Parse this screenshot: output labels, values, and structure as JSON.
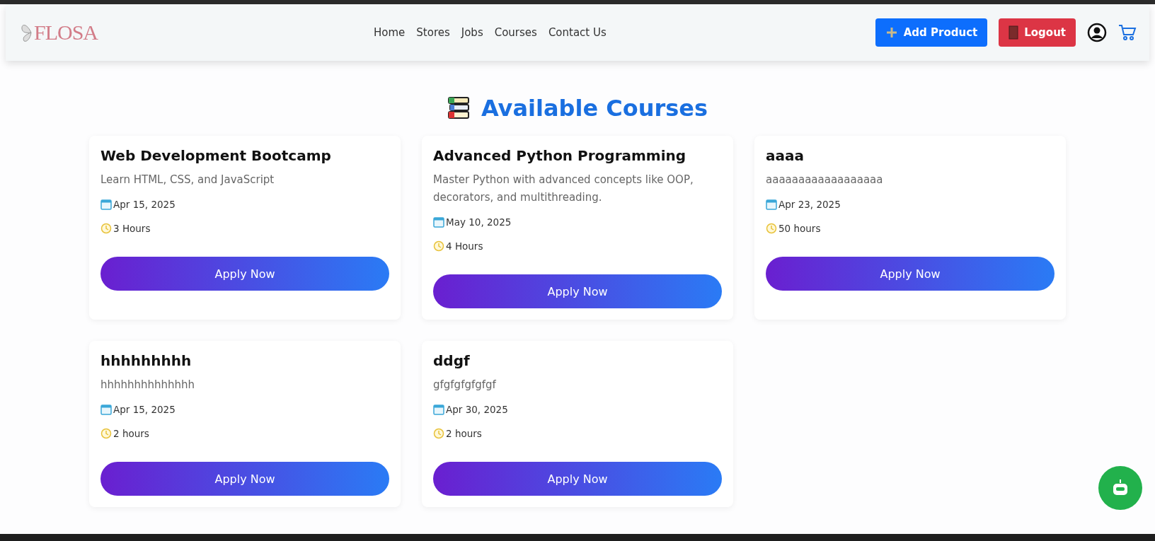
{
  "header": {
    "logo": "FLOSA",
    "nav": [
      {
        "label": "Home"
      },
      {
        "label": "Stores"
      },
      {
        "label": "Jobs"
      },
      {
        "label": "Courses"
      },
      {
        "label": "Contact Us"
      }
    ],
    "buttons": [
      {
        "kind": "add",
        "label": "Add Product"
      },
      {
        "kind": "logout",
        "label": "Logout"
      }
    ]
  },
  "heading": "Available Courses",
  "courses": [
    {
      "title": "Web Development Bootcamp",
      "description": "Learn HTML, CSS, and JavaScript",
      "date": "Apr 15, 2025",
      "duration": "3 Hours",
      "button": "Apply Now"
    },
    {
      "title": "Advanced Python Programming",
      "description": "Master Python with advanced concepts like OOP, decorators, and multithreading.",
      "date": "May 10, 2025",
      "duration": "4 Hours",
      "button": "Apply Now"
    },
    {
      "title": "aaaa",
      "description": "aaaaaaaaaaaaaaaaaa",
      "date": "Apr 23, 2025",
      "duration": "50 hours",
      "button": "Apply Now"
    },
    {
      "title": "hhhhhhhhh",
      "description": "hhhhhhhhhhhhhh",
      "date": "Apr 15, 2025",
      "duration": "2 hours",
      "button": "Apply Now"
    },
    {
      "title": "ddgf",
      "description": "gfgfgfgfgfgf",
      "date": "Apr 30, 2025",
      "duration": "2 hours",
      "button": "Apply Now"
    }
  ]
}
